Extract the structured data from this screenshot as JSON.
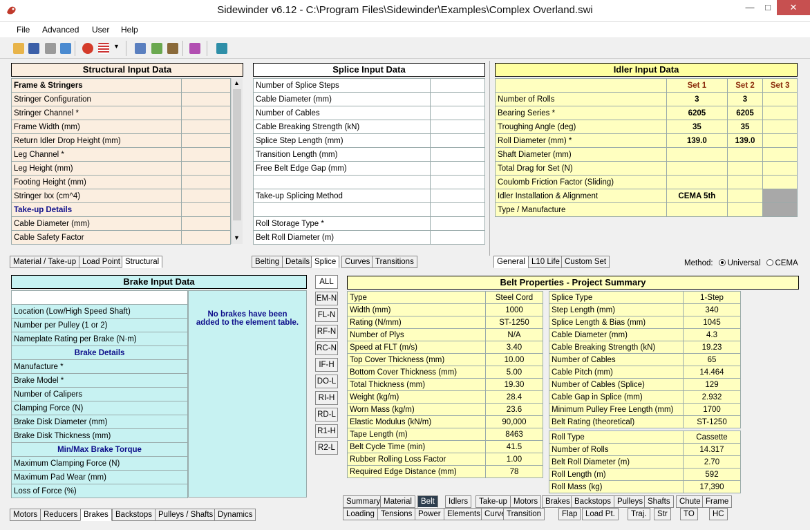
{
  "window": {
    "title": "Sidewinder v6.12 - C:\\Program Files\\Sidewinder\\Examples\\Complex Overland.swi"
  },
  "menu": [
    "File",
    "Advanced",
    "User",
    "Help"
  ],
  "toolbar_icons": [
    "open-icon",
    "save-icon",
    "print-icon",
    "edit-icon",
    "calculate-icon",
    "flag-icon",
    "dropdown-icon",
    "info-icon",
    "geometry-icon",
    "main-icon",
    "report-icon",
    "calculator-icon"
  ],
  "structural": {
    "title": "Structural Input Data",
    "rows": [
      {
        "label": "Frame & Stringers",
        "type": "bold"
      },
      {
        "label": "Stringer Configuration"
      },
      {
        "label": "Stringer Channel *"
      },
      {
        "label": "Frame Width (mm)"
      },
      {
        "label": "Return Idler Drop Height (mm)"
      },
      {
        "label": "Leg Channel *"
      },
      {
        "label": "Leg Height (mm)"
      },
      {
        "label": "Footing Height (mm)"
      },
      {
        "label": "Stringer Ixx (cm^4)"
      },
      {
        "label": "Take-up Details",
        "type": "hdr"
      },
      {
        "label": "Cable Diameter (mm)"
      },
      {
        "label": "Cable Safety Factor"
      }
    ],
    "tabs": [
      "Material / Take-up",
      "Load Point",
      "Structural"
    ]
  },
  "splice": {
    "title": "Splice Input Data",
    "rows": [
      "Number of Splice Steps",
      "Cable Diameter (mm)",
      "Number of Cables",
      "Cable Breaking Strength (kN)",
      "Splice Step Length (mm)",
      "Transition Length (mm)",
      "Free Belt Edge Gap (mm)",
      "",
      "Take-up Splicing Method",
      "",
      "Roll Storage Type *",
      "Belt Roll Diameter (m)"
    ],
    "tabs": [
      "Belting",
      "Details",
      "Splice",
      "Curves",
      "Transitions"
    ]
  },
  "idler": {
    "title": "Idler Input Data",
    "sets": [
      "Set 1",
      "Set 2",
      "Set 3"
    ],
    "rows": [
      {
        "label": "Number of Rolls",
        "v": [
          "3",
          "3",
          ""
        ]
      },
      {
        "label": "Bearing Series *",
        "v": [
          "6205",
          "6205",
          ""
        ]
      },
      {
        "label": "Troughing Angle (deg)",
        "v": [
          "35",
          "35",
          ""
        ]
      },
      {
        "label": "Roll Diameter (mm) *",
        "v": [
          "139.0",
          "139.0",
          ""
        ]
      },
      {
        "label": "Shaft Diameter (mm)",
        "v": [
          "",
          "",
          ""
        ]
      },
      {
        "label": "Total Drag for Set (N)",
        "v": [
          "",
          "",
          ""
        ]
      },
      {
        "label": "Coulomb Friction Factor (Sliding)",
        "v": [
          "",
          "",
          ""
        ]
      },
      {
        "label": "Idler Installation & Alignment",
        "v": [
          "CEMA 5th",
          "",
          ""
        ]
      },
      {
        "label": "Type / Manufacture",
        "v": [
          "",
          "",
          ""
        ]
      }
    ],
    "tabs": [
      "General",
      "L10 Life",
      "Custom Set"
    ],
    "method_label": "Method:",
    "method_options": [
      "Universal",
      "CEMA"
    ]
  },
  "brake": {
    "title": "Brake Input Data",
    "note": "No brakes have been added to the element table.",
    "rows": [
      {
        "label": ""
      },
      {
        "label": "Location (Low/High Speed Shaft)"
      },
      {
        "label": "Number per Pulley (1 or 2)"
      },
      {
        "label": "Nameplate Rating per Brake (N·m)"
      },
      {
        "label": "Brake Details",
        "type": "hdr"
      },
      {
        "label": "Manufacture *"
      },
      {
        "label": "Brake Model *"
      },
      {
        "label": "Number of Calipers"
      },
      {
        "label": "Clamping Force (N)"
      },
      {
        "label": "Brake Disk Diameter (mm)"
      },
      {
        "label": "Brake Disk Thickness (mm)"
      },
      {
        "label": "Min/Max Brake Torque",
        "type": "hdr"
      },
      {
        "label": "Maximum Clamping Force (N)"
      },
      {
        "label": "Maximum Pad Wear (mm)"
      },
      {
        "label": "Loss of Force (%)"
      }
    ],
    "tabs": [
      "Motors",
      "Reducers",
      "Brakes",
      "Backstops",
      "Pulleys / Shafts",
      "Dynamics"
    ]
  },
  "vertical_tabs": [
    "ALL",
    "EM-N",
    "FL-N",
    "RF-N",
    "RC-N",
    "IF-H",
    "DO-L",
    "RI-H",
    "RD-L",
    "R1-H",
    "R2-L"
  ],
  "belt": {
    "title": "Belt Properties - Project Summary",
    "left": [
      [
        "Type",
        "Steel Cord"
      ],
      [
        "Width (mm)",
        "1000"
      ],
      [
        "Rating (N/mm)",
        "ST-1250"
      ],
      [
        "Number of Plys",
        "N/A"
      ],
      [
        "Speed at FLT (m/s)",
        "3.40"
      ],
      [
        "Top Cover Thickness (mm)",
        "10.00"
      ],
      [
        "Bottom Cover Thickness (mm)",
        "5.00"
      ],
      [
        "Total Thickness (mm)",
        "19.30"
      ],
      [
        "Weight (kg/m)",
        "28.4"
      ],
      [
        "Worn Mass (kg/m)",
        "23.6"
      ],
      [
        "Elastic Modulus (kN/m)",
        "90,000"
      ],
      [
        "Tape Length (m)",
        "8463"
      ],
      [
        "Belt Cycle Time (min)",
        "41.5"
      ],
      [
        "Rubber Rolling Loss Factor",
        "1.00"
      ],
      [
        "Required Edge Distance (mm)",
        "78"
      ]
    ],
    "splice": [
      [
        "Splice Type",
        "1-Step"
      ],
      [
        "Step Length (mm)",
        "340"
      ],
      [
        "Splice Length & Bias (mm)",
        "1045"
      ],
      [
        "Cable Diameter (mm)",
        "4.3"
      ],
      [
        "Cable Breaking Strength (kN)",
        "19.23"
      ],
      [
        "Number of Cables",
        "65"
      ],
      [
        "Cable Pitch (mm)",
        "14.464"
      ],
      [
        "Number of Cables (Splice)",
        "129"
      ],
      [
        "Cable Gap in Splice (mm)",
        "2.932"
      ],
      [
        "Minimum Pulley Free Length (mm)",
        "1700"
      ],
      [
        "Belt Rating (theoretical)",
        "ST-1250"
      ]
    ],
    "roll": [
      [
        "Roll Type",
        "Cassette"
      ],
      [
        "Number of Rolls",
        "14.317"
      ],
      [
        "Belt Roll Diameter (m)",
        "2.70"
      ],
      [
        "Roll Length (m)",
        "592"
      ],
      [
        "Roll Mass (kg)",
        "17,390"
      ]
    ],
    "tabs1": [
      "Summary",
      "Material",
      "Belt",
      "Idlers",
      "Take-up",
      "Motors",
      "Brakes",
      "Backstops",
      "Pulleys",
      "Shafts",
      "Chute",
      "Frame"
    ],
    "tabs2": [
      "Loading",
      "Tensions",
      "Power",
      "Elements",
      "Curves",
      "Transition",
      "Flap",
      "Load Pt.",
      "Traj.",
      "Str",
      "TO",
      "HC"
    ]
  }
}
